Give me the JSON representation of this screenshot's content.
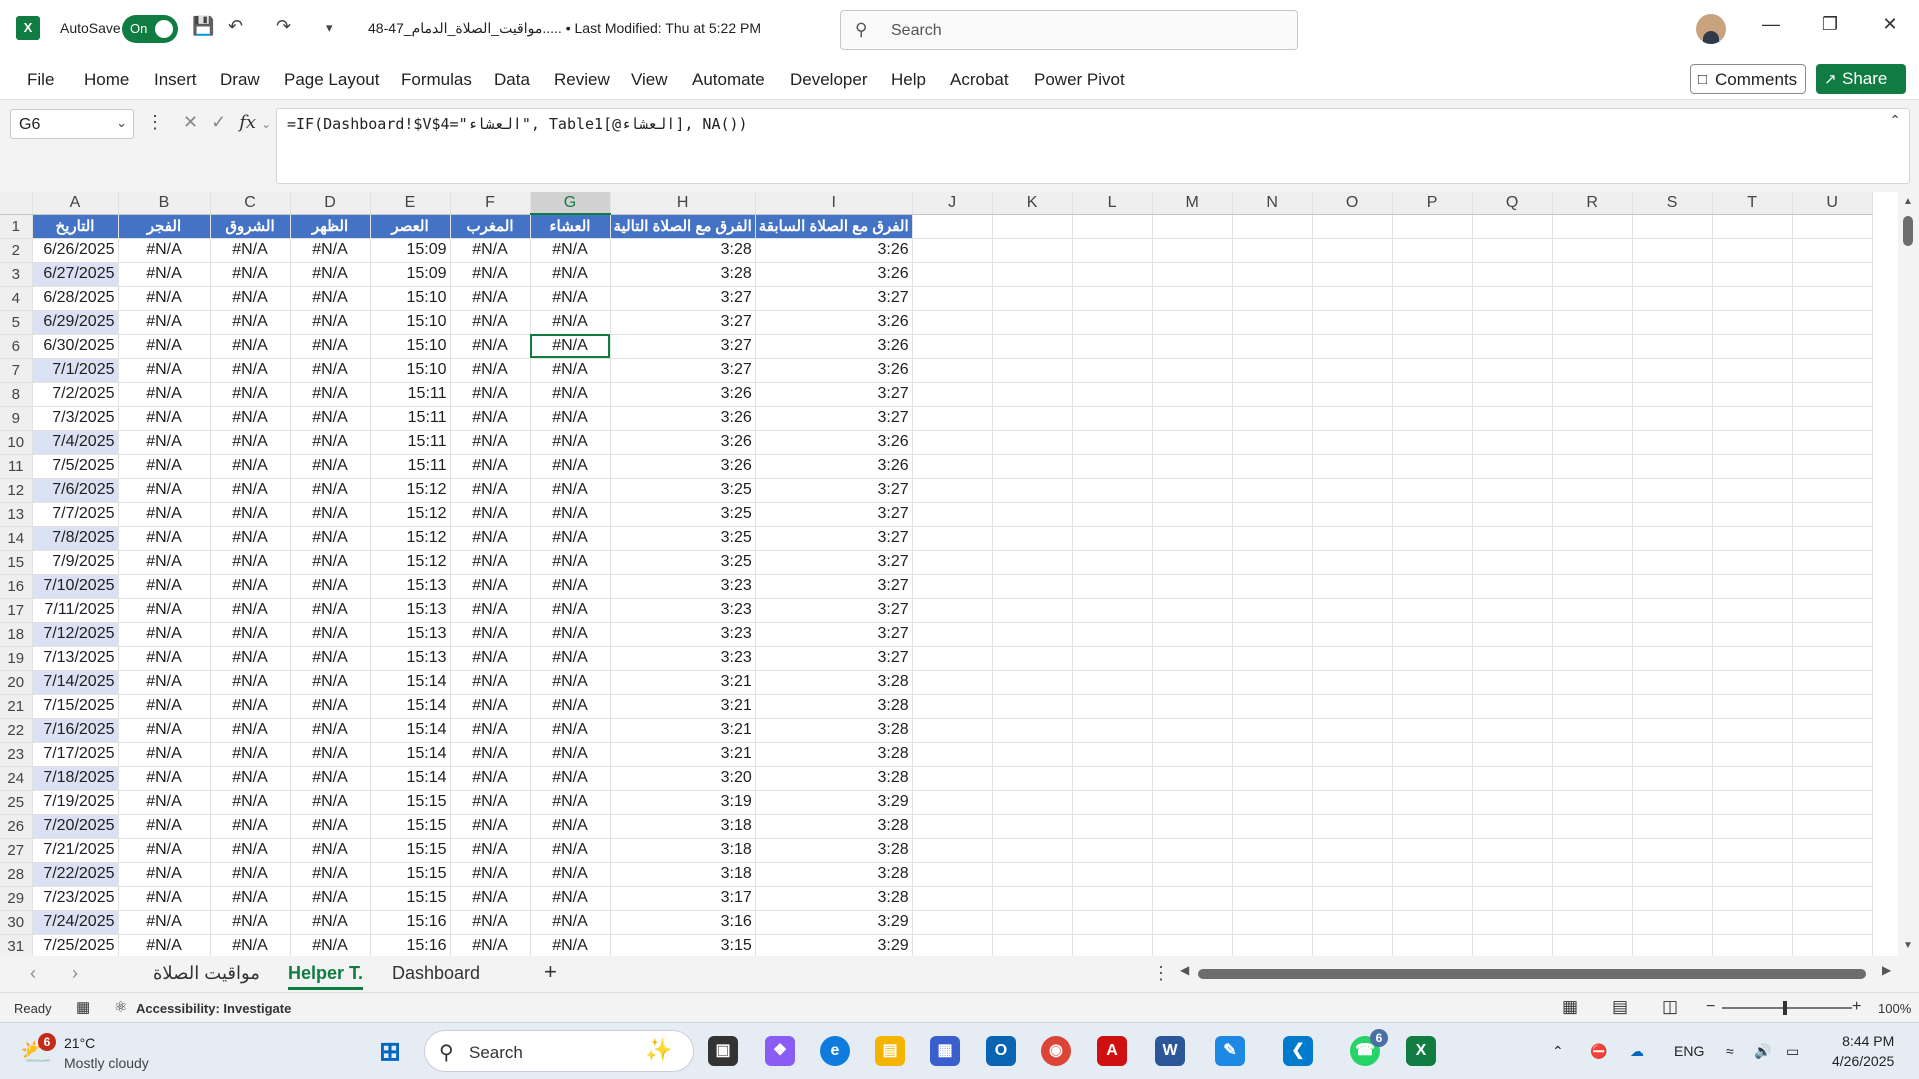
{
  "app": {
    "logo": "X",
    "autosave_label": "AutoSave",
    "autosave_state": "On",
    "doc_title": "48-47_مواقيت_الصلاة_الدمام..... • Last Modified: Thu at 5:22 PM",
    "search_placeholder": "Search"
  },
  "ribbon": {
    "tabs": [
      "File",
      "Home",
      "Insert",
      "Draw",
      "Page Layout",
      "Formulas",
      "Data",
      "Review",
      "View",
      "Automate",
      "Developer",
      "Help",
      "Acrobat",
      "Power Pivot"
    ],
    "comments_label": "Comments",
    "share_label": "Share"
  },
  "formula": {
    "name_box": "G6",
    "fx": "fx",
    "text": "=IF(Dashboard!$V$4=\"العشاء\", Table1[@العشاء], NA())"
  },
  "sheet": {
    "columns": [
      "A",
      "B",
      "C",
      "D",
      "E",
      "F",
      "G",
      "H",
      "I",
      "J",
      "K",
      "L",
      "M",
      "N",
      "O",
      "P",
      "Q",
      "R",
      "S",
      "T",
      "U"
    ],
    "selected_column": "G",
    "selected_cell": "G6",
    "headers": [
      "التاريخ",
      "الفجر",
      "الشروق",
      "الظهر",
      "العصر",
      "المغرب",
      "العشاء",
      "الفرق مع الصلاة التالية",
      "الفرق مع الصلاة السابقة"
    ],
    "rows": [
      [
        "6/26/2025",
        "#N/A",
        "#N/A",
        "#N/A",
        "15:09",
        "#N/A",
        "#N/A",
        "3:28",
        "3:26"
      ],
      [
        "6/27/2025",
        "#N/A",
        "#N/A",
        "#N/A",
        "15:09",
        "#N/A",
        "#N/A",
        "3:28",
        "3:26"
      ],
      [
        "6/28/2025",
        "#N/A",
        "#N/A",
        "#N/A",
        "15:10",
        "#N/A",
        "#N/A",
        "3:27",
        "3:27"
      ],
      [
        "6/29/2025",
        "#N/A",
        "#N/A",
        "#N/A",
        "15:10",
        "#N/A",
        "#N/A",
        "3:27",
        "3:26"
      ],
      [
        "6/30/2025",
        "#N/A",
        "#N/A",
        "#N/A",
        "15:10",
        "#N/A",
        "#N/A",
        "3:27",
        "3:26"
      ],
      [
        "7/1/2025",
        "#N/A",
        "#N/A",
        "#N/A",
        "15:10",
        "#N/A",
        "#N/A",
        "3:27",
        "3:26"
      ],
      [
        "7/2/2025",
        "#N/A",
        "#N/A",
        "#N/A",
        "15:11",
        "#N/A",
        "#N/A",
        "3:26",
        "3:27"
      ],
      [
        "7/3/2025",
        "#N/A",
        "#N/A",
        "#N/A",
        "15:11",
        "#N/A",
        "#N/A",
        "3:26",
        "3:27"
      ],
      [
        "7/4/2025",
        "#N/A",
        "#N/A",
        "#N/A",
        "15:11",
        "#N/A",
        "#N/A",
        "3:26",
        "3:26"
      ],
      [
        "7/5/2025",
        "#N/A",
        "#N/A",
        "#N/A",
        "15:11",
        "#N/A",
        "#N/A",
        "3:26",
        "3:26"
      ],
      [
        "7/6/2025",
        "#N/A",
        "#N/A",
        "#N/A",
        "15:12",
        "#N/A",
        "#N/A",
        "3:25",
        "3:27"
      ],
      [
        "7/7/2025",
        "#N/A",
        "#N/A",
        "#N/A",
        "15:12",
        "#N/A",
        "#N/A",
        "3:25",
        "3:27"
      ],
      [
        "7/8/2025",
        "#N/A",
        "#N/A",
        "#N/A",
        "15:12",
        "#N/A",
        "#N/A",
        "3:25",
        "3:27"
      ],
      [
        "7/9/2025",
        "#N/A",
        "#N/A",
        "#N/A",
        "15:12",
        "#N/A",
        "#N/A",
        "3:25",
        "3:27"
      ],
      [
        "7/10/2025",
        "#N/A",
        "#N/A",
        "#N/A",
        "15:13",
        "#N/A",
        "#N/A",
        "3:23",
        "3:27"
      ],
      [
        "7/11/2025",
        "#N/A",
        "#N/A",
        "#N/A",
        "15:13",
        "#N/A",
        "#N/A",
        "3:23",
        "3:27"
      ],
      [
        "7/12/2025",
        "#N/A",
        "#N/A",
        "#N/A",
        "15:13",
        "#N/A",
        "#N/A",
        "3:23",
        "3:27"
      ],
      [
        "7/13/2025",
        "#N/A",
        "#N/A",
        "#N/A",
        "15:13",
        "#N/A",
        "#N/A",
        "3:23",
        "3:27"
      ],
      [
        "7/14/2025",
        "#N/A",
        "#N/A",
        "#N/A",
        "15:14",
        "#N/A",
        "#N/A",
        "3:21",
        "3:28"
      ],
      [
        "7/15/2025",
        "#N/A",
        "#N/A",
        "#N/A",
        "15:14",
        "#N/A",
        "#N/A",
        "3:21",
        "3:28"
      ],
      [
        "7/16/2025",
        "#N/A",
        "#N/A",
        "#N/A",
        "15:14",
        "#N/A",
        "#N/A",
        "3:21",
        "3:28"
      ],
      [
        "7/17/2025",
        "#N/A",
        "#N/A",
        "#N/A",
        "15:14",
        "#N/A",
        "#N/A",
        "3:21",
        "3:28"
      ],
      [
        "7/18/2025",
        "#N/A",
        "#N/A",
        "#N/A",
        "15:14",
        "#N/A",
        "#N/A",
        "3:20",
        "3:28"
      ],
      [
        "7/19/2025",
        "#N/A",
        "#N/A",
        "#N/A",
        "15:15",
        "#N/A",
        "#N/A",
        "3:19",
        "3:29"
      ],
      [
        "7/20/2025",
        "#N/A",
        "#N/A",
        "#N/A",
        "15:15",
        "#N/A",
        "#N/A",
        "3:18",
        "3:28"
      ],
      [
        "7/21/2025",
        "#N/A",
        "#N/A",
        "#N/A",
        "15:15",
        "#N/A",
        "#N/A",
        "3:18",
        "3:28"
      ],
      [
        "7/22/2025",
        "#N/A",
        "#N/A",
        "#N/A",
        "15:15",
        "#N/A",
        "#N/A",
        "3:18",
        "3:28"
      ],
      [
        "7/23/2025",
        "#N/A",
        "#N/A",
        "#N/A",
        "15:15",
        "#N/A",
        "#N/A",
        "3:17",
        "3:28"
      ],
      [
        "7/24/2025",
        "#N/A",
        "#N/A",
        "#N/A",
        "15:16",
        "#N/A",
        "#N/A",
        "3:16",
        "3:29"
      ],
      [
        "7/25/2025",
        "#N/A",
        "#N/A",
        "#N/A",
        "15:16",
        "#N/A",
        "#N/A",
        "3:15",
        "3:29"
      ]
    ],
    "highlight_dates": [
      1,
      3,
      5,
      8,
      10,
      12,
      14,
      16,
      18,
      20,
      22,
      24,
      26,
      28
    ]
  },
  "sheet_tabs": {
    "tabs": [
      "مواقيت الصلاة",
      "Helper T.",
      "Dashboard"
    ],
    "active": "Helper T.",
    "add_label": "+"
  },
  "status": {
    "ready": "Ready",
    "accessibility": "Accessibility: Investigate",
    "zoom": "100%"
  },
  "taskbar": {
    "temperature": "21°C",
    "condition": "Mostly cloudy",
    "weather_badge": "6",
    "search_label": "Search",
    "whatsapp_badge": "6",
    "lang": "ENG",
    "time": "8:44 PM",
    "date": "4/26/2025"
  },
  "colors": {
    "excel_green": "#107c41",
    "table_header": "#4472c4",
    "date_highlight": "#d9e1f2"
  }
}
